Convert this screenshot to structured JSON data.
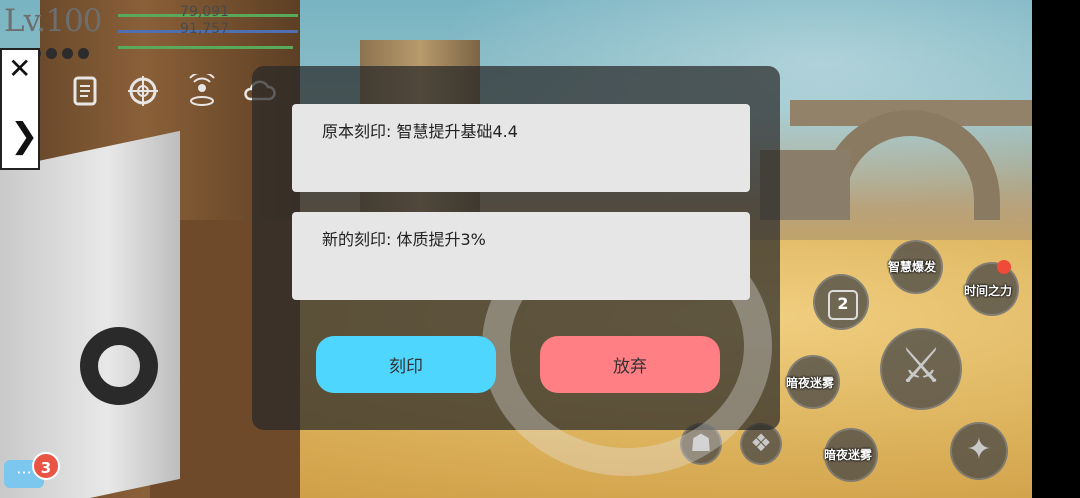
{
  "hud": {
    "level": "Lv.100",
    "hp": "79,091",
    "mp": "91,757"
  },
  "side_panel": {
    "close_icon": "close-icon",
    "next_icon": "chevron-right-icon"
  },
  "menu_icons": [
    "scroll-icon",
    "crosshair-icon",
    "signal-icon",
    "cloud-icon"
  ],
  "dialog": {
    "original_label": "原本刻印: 智慧提升基础4.4",
    "new_label": "新的刻印: 体质提升3%",
    "engrave_button": "刻印",
    "abandon_button": "放弃"
  },
  "skills": {
    "wisdom_burst": "智慧爆发",
    "time_power": "时间之力",
    "dark_fog_1": "暗夜迷雾",
    "dark_fog_2": "暗夜迷雾",
    "slot_number": "2"
  },
  "chat": {
    "unread_count": "3"
  },
  "colors": {
    "engrave_button": "#4fd6ff",
    "abandon_button": "#ff7f84",
    "chat_badge": "#e95444"
  }
}
